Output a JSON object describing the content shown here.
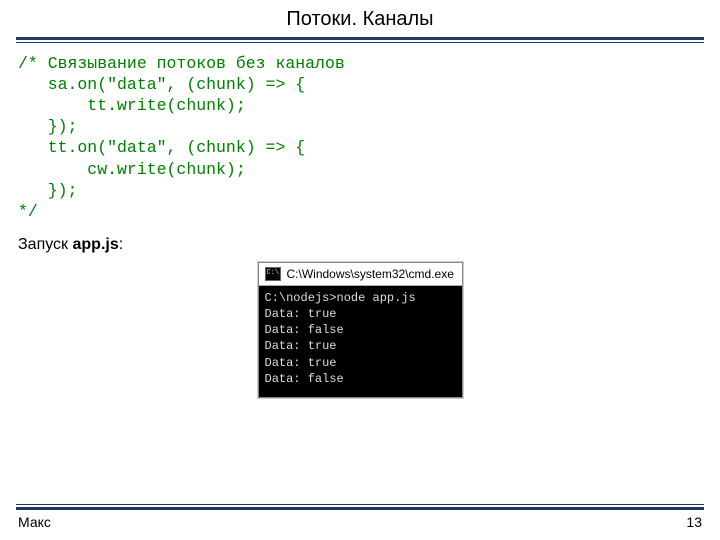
{
  "header": {
    "title": "Потоки. Каналы"
  },
  "code": {
    "line1": "/* Связывание потоков без каналов",
    "line2": "   sa.on(\"data\", (chunk) => {",
    "line3": "       tt.write(chunk);",
    "line4": "   });",
    "line5": "   tt.on(\"data\", (chunk) => {",
    "line6": "       cw.write(chunk);",
    "line7": "   });",
    "line8": "*/"
  },
  "launch": {
    "prefix": "Запуск ",
    "bold": "app.js",
    "suffix": ":"
  },
  "terminal": {
    "title": "C:\\Windows\\system32\\cmd.exe",
    "body": "C:\\nodejs>node app.js\nData: true\nData: false\nData: true\nData: true\nData: false"
  },
  "footer": {
    "author": "Макс",
    "page": "13"
  }
}
